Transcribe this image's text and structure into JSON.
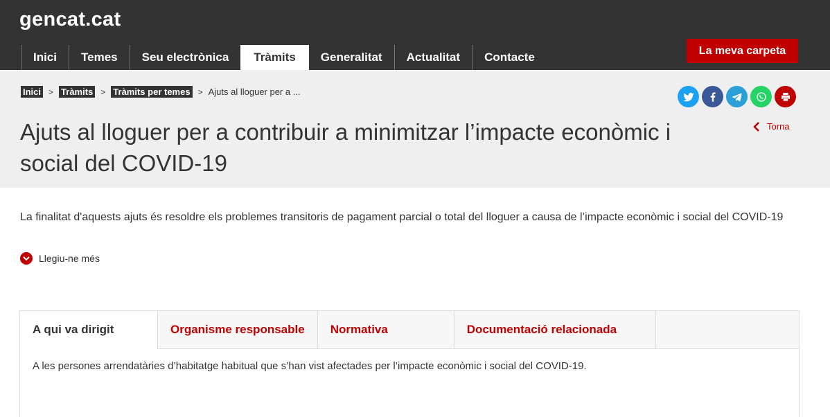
{
  "header": {
    "logo": "gencat.cat",
    "nav": [
      {
        "label": "Inici",
        "active": false
      },
      {
        "label": "Temes",
        "active": false
      },
      {
        "label": "Seu electrònica",
        "active": false
      },
      {
        "label": "Tràmits",
        "active": true
      },
      {
        "label": "Generalitat",
        "active": false
      },
      {
        "label": "Actualitat",
        "active": false
      },
      {
        "label": "Contacte",
        "active": false
      }
    ],
    "carpeta_button": "La meva carpeta"
  },
  "breadcrumb": {
    "items": [
      "Inici",
      "Tràmits",
      "Tràmits per temes"
    ],
    "separator": ">",
    "current": "Ajuts al lloguer per a ..."
  },
  "page": {
    "title": "Ajuts al lloguer per a contribuir a minimitzar l’impacte econòmic i social del COVID-19",
    "back_label": "Torna",
    "intro": "La finalitat d'aquests ajuts és resoldre els problemes transitoris de pagament parcial o total del lloguer a causa de l’impacte econòmic i social del COVID-19",
    "read_more": "Llegiu-ne més"
  },
  "social": [
    {
      "icon": "twitter-icon",
      "color": "#1da1f2"
    },
    {
      "icon": "facebook-icon",
      "color": "#3b5998"
    },
    {
      "icon": "telegram-icon",
      "color": "#2a9fd8"
    },
    {
      "icon": "whatsapp-icon",
      "color": "#25d366"
    },
    {
      "icon": "print-icon",
      "color": "#c00000"
    }
  ],
  "tabs": {
    "items": [
      "A qui va dirigit",
      "Organisme responsable",
      "Normativa",
      "Documentació relacionada"
    ],
    "active_index": 0,
    "content": "A les persones arrendatàries d’habitatge habitual que s’han vist afectades per l’impacte econòmic i social del COVID-19."
  },
  "colors": {
    "brand_red": "#c00000",
    "header_bg": "#333333",
    "band_bg": "#efefef"
  }
}
